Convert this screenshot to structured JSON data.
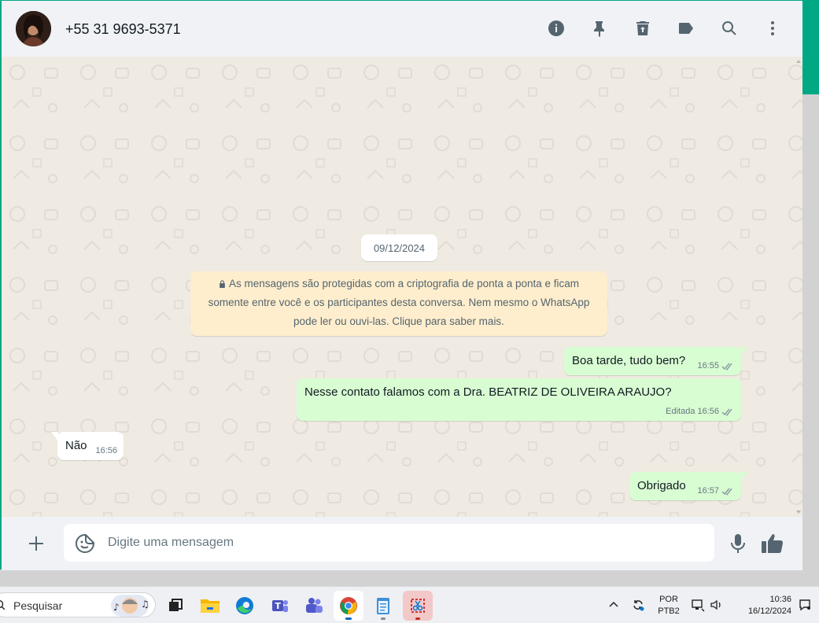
{
  "header": {
    "contact_name": "+55 31 9693-5371",
    "icons": [
      "info-icon",
      "pin-icon",
      "clear-chat-icon",
      "label-icon",
      "search-icon",
      "menu-icon"
    ]
  },
  "chat": {
    "date_separator": "09/12/2024",
    "encryption_notice": "As mensagens são protegidas com a criptografia de ponta a ponta e ficam somente entre você e os participantes desta conversa. Nem mesmo o WhatsApp pode ler ou ouvi-las. Clique para saber mais.",
    "messages": [
      {
        "direction": "outgoing",
        "text": "Boa tarde, tudo bem?",
        "time": "16:55",
        "status": "read"
      },
      {
        "direction": "outgoing",
        "text": "Nesse contato falamos com a Dra. BEATRIZ DE OLIVEIRA ARAUJO?",
        "edited_label": "Editada",
        "time": "16:56",
        "status": "read"
      },
      {
        "direction": "incoming",
        "text": "Não",
        "time": "16:56"
      },
      {
        "direction": "outgoing",
        "text": "Obrigado",
        "time": "16:57",
        "status": "read"
      }
    ]
  },
  "composer": {
    "placeholder": "Digite uma mensagem",
    "value": ""
  },
  "taskbar": {
    "search_label": "Pesquisar",
    "language_line1": "POR",
    "language_line2": "PTB2",
    "clock_time": "10:36",
    "clock_date": "16/12/2024"
  },
  "colors": {
    "accent": "#00a884",
    "outgoing_bubble": "#d9fdd3",
    "incoming_bubble": "#ffffff",
    "encryption_bg": "#ffeecd",
    "chat_bg": "#efeae2",
    "read_ticks": "#8696a0"
  }
}
